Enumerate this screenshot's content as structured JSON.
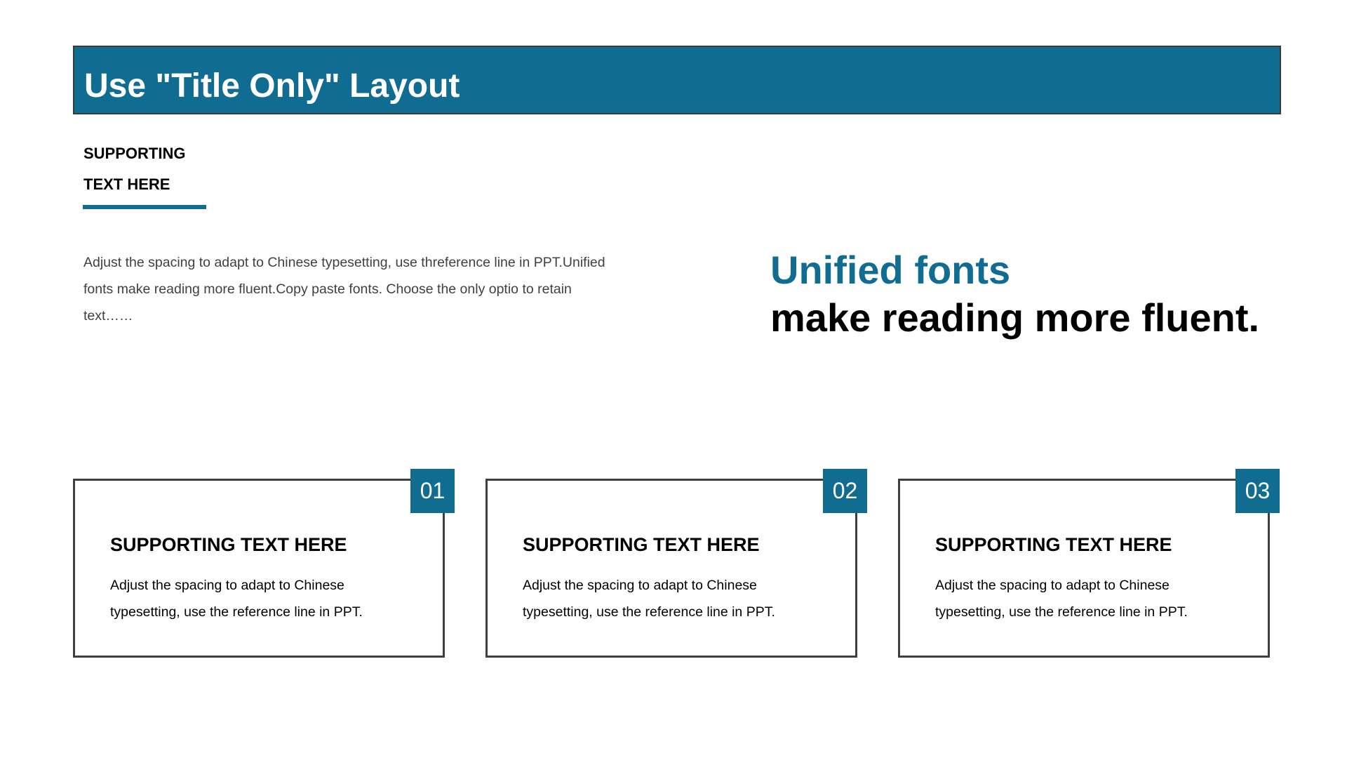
{
  "slide": {
    "title": "Use \"Title Only\" Layout",
    "supporting": {
      "line1": "SUPPORTING",
      "line2": "TEXT HERE"
    },
    "intro_text": "Adjust the spacing to adapt to Chinese typesetting, use threference line in PPT.Unified fonts make reading more fluent.Copy paste fonts. Choose the only optio to retain text……",
    "headline": {
      "accent": "Unified fonts",
      "main": "make reading more fluent."
    },
    "cards": [
      {
        "number": "01",
        "title": "SUPPORTING TEXT HERE",
        "body": "Adjust the spacing to adapt to Chinese typesetting, use the reference line in PPT."
      },
      {
        "number": "02",
        "title": "SUPPORTING TEXT HERE",
        "body": "Adjust the spacing to adapt to Chinese typesetting, use the reference line in PPT."
      },
      {
        "number": "03",
        "title": "SUPPORTING TEXT HERE",
        "body": "Adjust the spacing to adapt to Chinese typesetting, use the reference line in PPT."
      }
    ]
  },
  "colors": {
    "accent": "#106d91",
    "border": "#3f3f3f",
    "text": "#000000",
    "muted_text": "#404040"
  }
}
